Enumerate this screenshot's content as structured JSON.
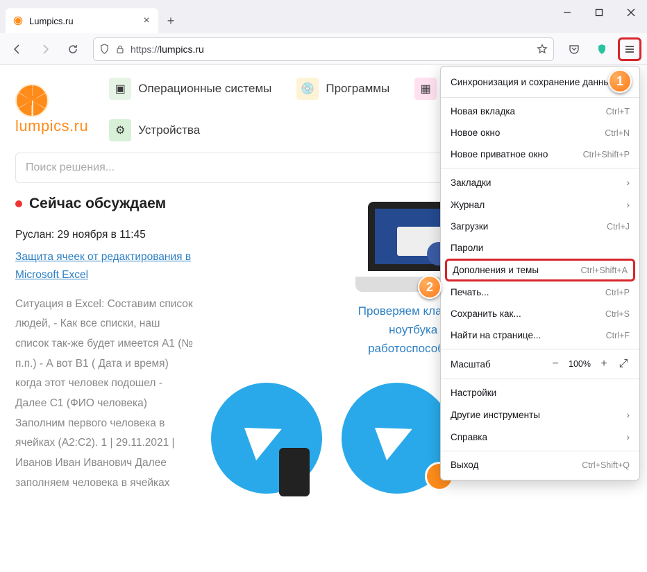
{
  "tab": {
    "title": "Lumpics.ru"
  },
  "url": {
    "prefix": "https://",
    "host": "lumpics.ru"
  },
  "site": {
    "logo_text": "lumpics.ru",
    "nav": [
      {
        "label": "Операционные системы"
      },
      {
        "label": "Программы"
      },
      {
        "label": "Устройства"
      }
    ],
    "search_placeholder": "Поиск решения..."
  },
  "sidebar": {
    "heading": "Сейчас обсуждаем",
    "author_line": "Руслан: 29 ноября в 11:45",
    "post_link": "Защита ячеек от редактирования в Microsoft Excel",
    "post_body": "Ситуация в Excel: Составим список людей, - Как все списки, наш список так-же будет имеется A1 (№ п.п.) - А вот B1 ( Дата и время) когда этот человек подошел - Далее C1 (ФИО человека) Заполним первого человека в ячейках (A2:C2). 1 | 29.11.2021 | Иванов Иван Иванович Далее заполняем человека в ячейках"
  },
  "card": {
    "title": "Проверяем клавиатуру ноутбука на работоспособность"
  },
  "menu": {
    "sync": "Синхронизация и сохранение данных",
    "items": [
      {
        "label": "Новая вкладка",
        "shortcut": "Ctrl+T"
      },
      {
        "label": "Новое окно",
        "shortcut": "Ctrl+N"
      },
      {
        "label": "Новое приватное окно",
        "shortcut": "Ctrl+Shift+P"
      }
    ],
    "items2": [
      {
        "label": "Закладки",
        "arrow": true
      },
      {
        "label": "Журнал",
        "arrow": true
      },
      {
        "label": "Загрузки",
        "shortcut": "Ctrl+J"
      },
      {
        "label": "Пароли"
      }
    ],
    "addons": {
      "label": "Дополнения и темы",
      "shortcut": "Ctrl+Shift+A"
    },
    "items3": [
      {
        "label": "Печать...",
        "shortcut": "Ctrl+P"
      },
      {
        "label": "Сохранить как...",
        "shortcut": "Ctrl+S"
      },
      {
        "label": "Найти на странице...",
        "shortcut": "Ctrl+F"
      }
    ],
    "zoom": {
      "label": "Масштаб",
      "value": "100%"
    },
    "items4": [
      {
        "label": "Настройки"
      },
      {
        "label": "Другие инструменты",
        "arrow": true
      },
      {
        "label": "Справка",
        "arrow": true
      }
    ],
    "exit": {
      "label": "Выход",
      "shortcut": "Ctrl+Shift+Q"
    }
  },
  "callouts": {
    "c1": "1",
    "c2": "2"
  }
}
